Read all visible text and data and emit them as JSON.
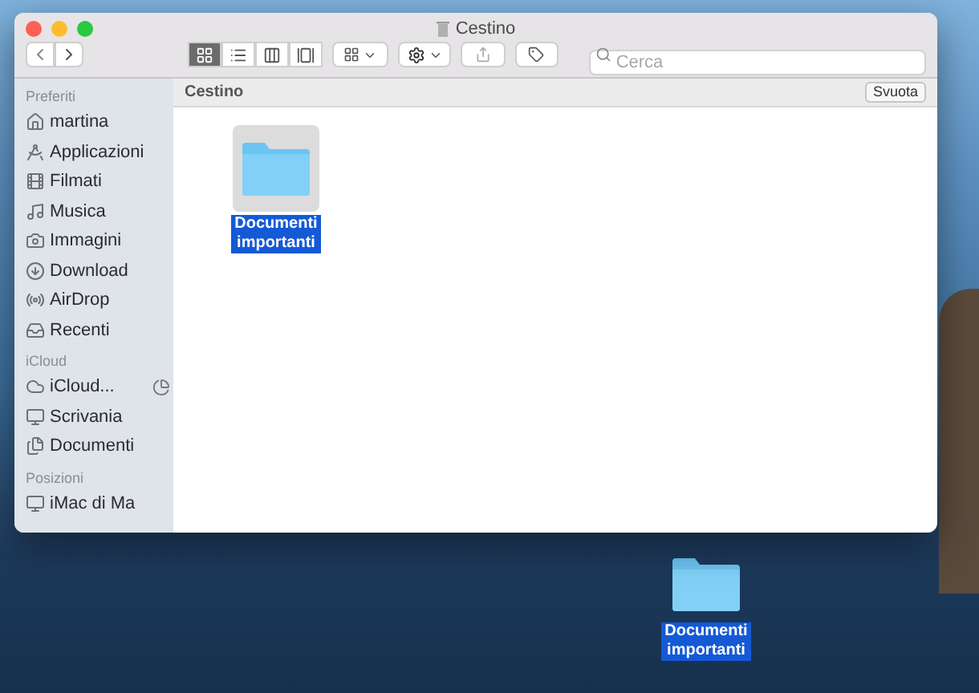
{
  "window": {
    "title": "Cestino"
  },
  "toolbar": {
    "view_modes": [
      {
        "selected": true
      },
      {
        "selected": false
      },
      {
        "selected": false
      },
      {
        "selected": false
      }
    ],
    "search": {
      "placeholder": "Cerca"
    }
  },
  "sidebar": {
    "sections": [
      {
        "title": "Preferiti",
        "items": [
          {
            "label": "martina"
          },
          {
            "label": "Applicazioni"
          },
          {
            "label": "Filmati"
          },
          {
            "label": "Musica"
          },
          {
            "label": "Immagini"
          },
          {
            "label": "Download"
          },
          {
            "label": "AirDrop"
          },
          {
            "label": "Recenti"
          }
        ]
      },
      {
        "title": "iCloud",
        "items": [
          {
            "label": "iCloud..."
          },
          {
            "label": "Scrivania"
          },
          {
            "label": "Documenti"
          }
        ]
      },
      {
        "title": "Posizioni",
        "items": [
          {
            "label": "iMac di Ma"
          }
        ]
      }
    ]
  },
  "path_bar": {
    "title": "Cestino",
    "button": "Svuota"
  },
  "files": [
    {
      "name": "Documenti importanti",
      "selected": true
    }
  ],
  "desktop": {
    "icons": [
      {
        "name": "Documenti importanti",
        "selected": true
      }
    ]
  }
}
